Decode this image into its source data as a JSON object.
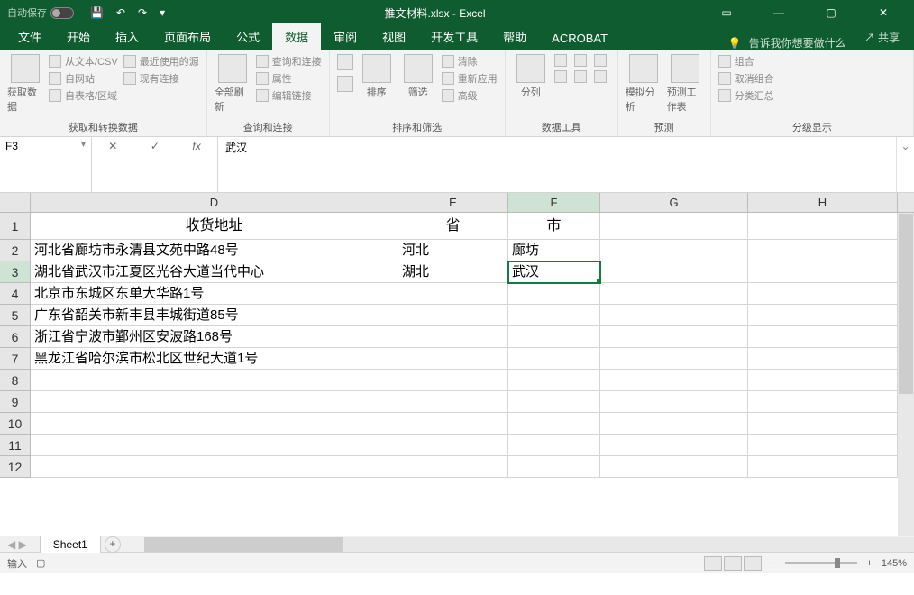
{
  "title": "推文材料.xlsx - Excel",
  "auto_save": "自动保存",
  "tabs": [
    "文件",
    "开始",
    "插入",
    "页面布局",
    "公式",
    "数据",
    "审阅",
    "视图",
    "开发工具",
    "帮助",
    "ACROBAT"
  ],
  "tell_me": "告诉我你想要做什么",
  "share": "共享",
  "groups": {
    "g1": {
      "btn": "获取数据",
      "items": [
        "从文本/CSV",
        "最近使用的源",
        "自网站",
        "现有连接",
        "自表格/区域"
      ],
      "label": "获取和转换数据"
    },
    "g2": {
      "btn": "全部刷新",
      "items": [
        "查询和连接",
        "属性",
        "编辑链接"
      ],
      "label": "查询和连接"
    },
    "g3": {
      "btn": "排序",
      "btn2": "筛选",
      "items": [
        "清除",
        "重新应用",
        "高级"
      ],
      "label": "排序和筛选"
    },
    "g4": {
      "btn": "分列",
      "label": "数据工具"
    },
    "g5": {
      "btn": "模拟分析",
      "btn2": "预测工作表",
      "label": "预测"
    },
    "g6": {
      "items": [
        "组合",
        "取消组合",
        "分类汇总"
      ],
      "label": "分级显示"
    }
  },
  "name_box": "F3",
  "formula": "武汉",
  "columns": [
    "D",
    "E",
    "F",
    "G",
    "H"
  ],
  "row_headers": [
    "1",
    "2",
    "3",
    "4",
    "5",
    "6",
    "7",
    "8",
    "9",
    "10",
    "11",
    "12"
  ],
  "header_row": {
    "D": "收货地址",
    "E": "省",
    "F": "市"
  },
  "data_rows": [
    {
      "D": "河北省廊坊市永清县文苑中路48号",
      "E": "河北",
      "F": "廊坊"
    },
    {
      "D": "湖北省武汉市江夏区光谷大道当代中心",
      "E": "湖北",
      "F": "武汉"
    },
    {
      "D": "北京市东城区东单大华路1号",
      "E": "",
      "F": ""
    },
    {
      "D": "广东省韶关市新丰县丰城街道85号",
      "E": "",
      "F": ""
    },
    {
      "D": "浙江省宁波市鄞州区安波路168号",
      "E": "",
      "F": ""
    },
    {
      "D": "黑龙江省哈尔滨市松北区世纪大道1号",
      "E": "",
      "F": ""
    }
  ],
  "sheet": "Sheet1",
  "status": "输入",
  "zoom": "145%"
}
